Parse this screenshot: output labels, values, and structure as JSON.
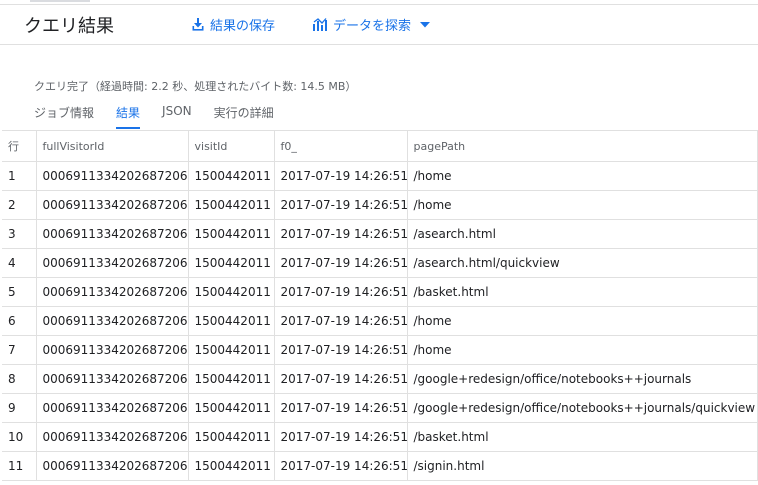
{
  "header": {
    "title": "クエリ結果",
    "save_label": "結果の保存",
    "explore_label": "データを探索",
    "icons": {
      "save": "download-icon",
      "explore": "chart-icon",
      "caret": "caret-down-icon"
    }
  },
  "status": {
    "text": "クエリ完了（経過時間: 2.2 秒、処理されたバイト数: 14.5 MB）"
  },
  "tabs": [
    {
      "label": "ジョブ情報",
      "active": false
    },
    {
      "label": "結果",
      "active": true
    },
    {
      "label": "JSON",
      "active": false
    },
    {
      "label": "実行の詳細",
      "active": false
    }
  ],
  "table": {
    "columns": [
      "行",
      "fullVisitorId",
      "visitId",
      "f0_",
      "pagePath"
    ],
    "rows": [
      [
        "1",
        "0006911334202687206",
        "1500442011",
        "2017-07-19 14:26:51",
        "/home"
      ],
      [
        "2",
        "0006911334202687206",
        "1500442011",
        "2017-07-19 14:26:51",
        "/home"
      ],
      [
        "3",
        "0006911334202687206",
        "1500442011",
        "2017-07-19 14:26:51",
        "/asearch.html"
      ],
      [
        "4",
        "0006911334202687206",
        "1500442011",
        "2017-07-19 14:26:51",
        "/asearch.html/quickview"
      ],
      [
        "5",
        "0006911334202687206",
        "1500442011",
        "2017-07-19 14:26:51",
        "/basket.html"
      ],
      [
        "6",
        "0006911334202687206",
        "1500442011",
        "2017-07-19 14:26:51",
        "/home"
      ],
      [
        "7",
        "0006911334202687206",
        "1500442011",
        "2017-07-19 14:26:51",
        "/home"
      ],
      [
        "8",
        "0006911334202687206",
        "1500442011",
        "2017-07-19 14:26:51",
        "/google+redesign/office/notebooks++journals"
      ],
      [
        "9",
        "0006911334202687206",
        "1500442011",
        "2017-07-19 14:26:51",
        "/google+redesign/office/notebooks++journals/quickview"
      ],
      [
        "10",
        "0006911334202687206",
        "1500442011",
        "2017-07-19 14:26:51",
        "/basket.html"
      ],
      [
        "11",
        "0006911334202687206",
        "1500442011",
        "2017-07-19 14:26:51",
        "/signin.html"
      ]
    ]
  },
  "colors": {
    "accent": "#1a73e8",
    "text": "#202124",
    "muted": "#5f6368",
    "border": "#e0e0e0"
  }
}
